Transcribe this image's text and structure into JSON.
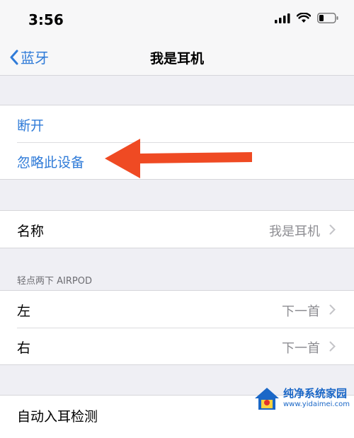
{
  "status_bar": {
    "time": "3:56",
    "icons": [
      "cellular-signal-icon",
      "wifi-icon",
      "battery-icon"
    ]
  },
  "nav": {
    "back_label": "蓝牙",
    "title": "我是耳机"
  },
  "actions": {
    "disconnect": "断开",
    "forget_device": "忽略此设备"
  },
  "name_row": {
    "label": "名称",
    "value": "我是耳机"
  },
  "double_tap": {
    "header": "轻点两下 AIRPOD",
    "left": {
      "label": "左",
      "value": "下一首"
    },
    "right": {
      "label": "右",
      "value": "下一首"
    }
  },
  "ear_detection": {
    "label": "自动入耳检测"
  },
  "watermark": {
    "line1": "纯净系统家园",
    "line2": "www.yidaimei.com"
  },
  "colors": {
    "accent": "#2f7bd8",
    "annotation_arrow": "#ef4a23",
    "background": "#efeff4"
  }
}
